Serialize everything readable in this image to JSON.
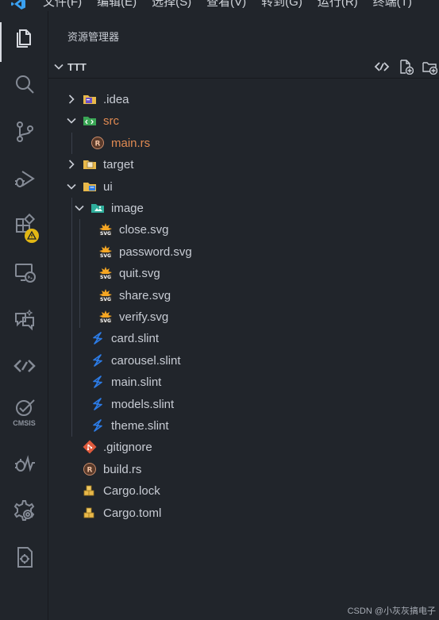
{
  "menubar": {
    "items": [
      "文件(F)",
      "编辑(E)",
      "选择(S)",
      "查看(V)",
      "转到(G)",
      "运行(R)",
      "终端(T)"
    ]
  },
  "activity_bar": {
    "items": [
      {
        "name": "explorer-icon",
        "active": true
      },
      {
        "name": "search-icon"
      },
      {
        "name": "source-control-icon"
      },
      {
        "name": "run-debug-icon"
      },
      {
        "name": "extensions-icon",
        "badge": "warning"
      },
      {
        "name": "remote-explorer-icon"
      },
      {
        "name": "chat-icon"
      },
      {
        "name": "code-link-icon"
      },
      {
        "name": "cmsis-icon",
        "label": "CMSIS"
      },
      {
        "name": "debug-trace-icon"
      },
      {
        "name": "settings-bug-icon"
      },
      {
        "name": "device-manager-icon"
      }
    ]
  },
  "panel": {
    "title": "资源管理器",
    "workspace": "TTT"
  },
  "tree": [
    {
      "label": ".idea",
      "type": "folder",
      "expanded": false,
      "depth": 0,
      "icon": "idea-folder-icon"
    },
    {
      "label": "src",
      "type": "folder",
      "expanded": true,
      "depth": 0,
      "icon": "src-folder-icon",
      "color": "orange"
    },
    {
      "label": "main.rs",
      "type": "file",
      "depth": 1,
      "icon": "rust-file-icon",
      "color": "orange"
    },
    {
      "label": "target",
      "type": "folder",
      "expanded": false,
      "depth": 0,
      "icon": "target-folder-icon"
    },
    {
      "label": "ui",
      "type": "folder",
      "expanded": true,
      "depth": 0,
      "icon": "ui-folder-icon"
    },
    {
      "label": "image",
      "type": "folder",
      "expanded": true,
      "depth": 1,
      "icon": "image-folder-icon"
    },
    {
      "label": "close.svg",
      "type": "file",
      "depth": 2,
      "icon": "svg-file-icon"
    },
    {
      "label": "password.svg",
      "type": "file",
      "depth": 2,
      "icon": "svg-file-icon"
    },
    {
      "label": "quit.svg",
      "type": "file",
      "depth": 2,
      "icon": "svg-file-icon"
    },
    {
      "label": "share.svg",
      "type": "file",
      "depth": 2,
      "icon": "svg-file-icon"
    },
    {
      "label": "verify.svg",
      "type": "file",
      "depth": 2,
      "icon": "svg-file-icon"
    },
    {
      "label": "card.slint",
      "type": "file",
      "depth": 1,
      "icon": "slint-file-icon"
    },
    {
      "label": "carousel.slint",
      "type": "file",
      "depth": 1,
      "icon": "slint-file-icon"
    },
    {
      "label": "main.slint",
      "type": "file",
      "depth": 1,
      "icon": "slint-file-icon"
    },
    {
      "label": "models.slint",
      "type": "file",
      "depth": 1,
      "icon": "slint-file-icon"
    },
    {
      "label": "theme.slint",
      "type": "file",
      "depth": 1,
      "icon": "slint-file-icon"
    },
    {
      "label": ".gitignore",
      "type": "file",
      "depth": 0,
      "icon": "git-file-icon"
    },
    {
      "label": "build.rs",
      "type": "file",
      "depth": 0,
      "icon": "rust-file-icon"
    },
    {
      "label": "Cargo.lock",
      "type": "file",
      "depth": 0,
      "icon": "cargo-file-icon"
    },
    {
      "label": "Cargo.toml",
      "type": "file",
      "depth": 0,
      "icon": "cargo-file-icon"
    }
  ],
  "watermark": "CSDN @小灰灰搞电子",
  "colors": {
    "background": "#21252b",
    "accent_folder": "#e8b84a",
    "slint": "#2c7be5",
    "src_green": "#3aa655",
    "warning_badge": "#e2b714"
  }
}
